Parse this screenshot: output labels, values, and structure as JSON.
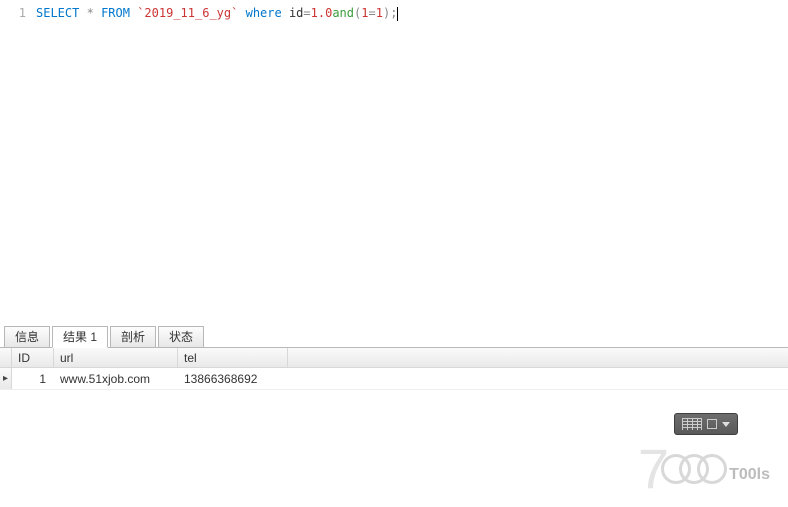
{
  "editor": {
    "line_number": "1",
    "tokens": {
      "select": "SELECT",
      "star": "*",
      "from": "FROM",
      "table": "`2019_11_6_yg`",
      "where": "where",
      "id_eq": "id",
      "eq": "=",
      "val1": "1.0",
      "and": "and",
      "paren_open": "(",
      "one_a": "1",
      "eq2": "=",
      "one_b": "1",
      "paren_close": ")",
      "semi": ";"
    }
  },
  "tabs": [
    {
      "label": "信息"
    },
    {
      "label": "结果 1"
    },
    {
      "label": "剖析"
    },
    {
      "label": "状态"
    }
  ],
  "grid": {
    "columns": {
      "id": "ID",
      "url": "url",
      "tel": "tel"
    },
    "rows": [
      {
        "id": "1",
        "url": "www.51xjob.com",
        "tel": "13866368692"
      }
    ]
  },
  "watermark": {
    "brand_digit": "7",
    "label": "T00ls"
  }
}
